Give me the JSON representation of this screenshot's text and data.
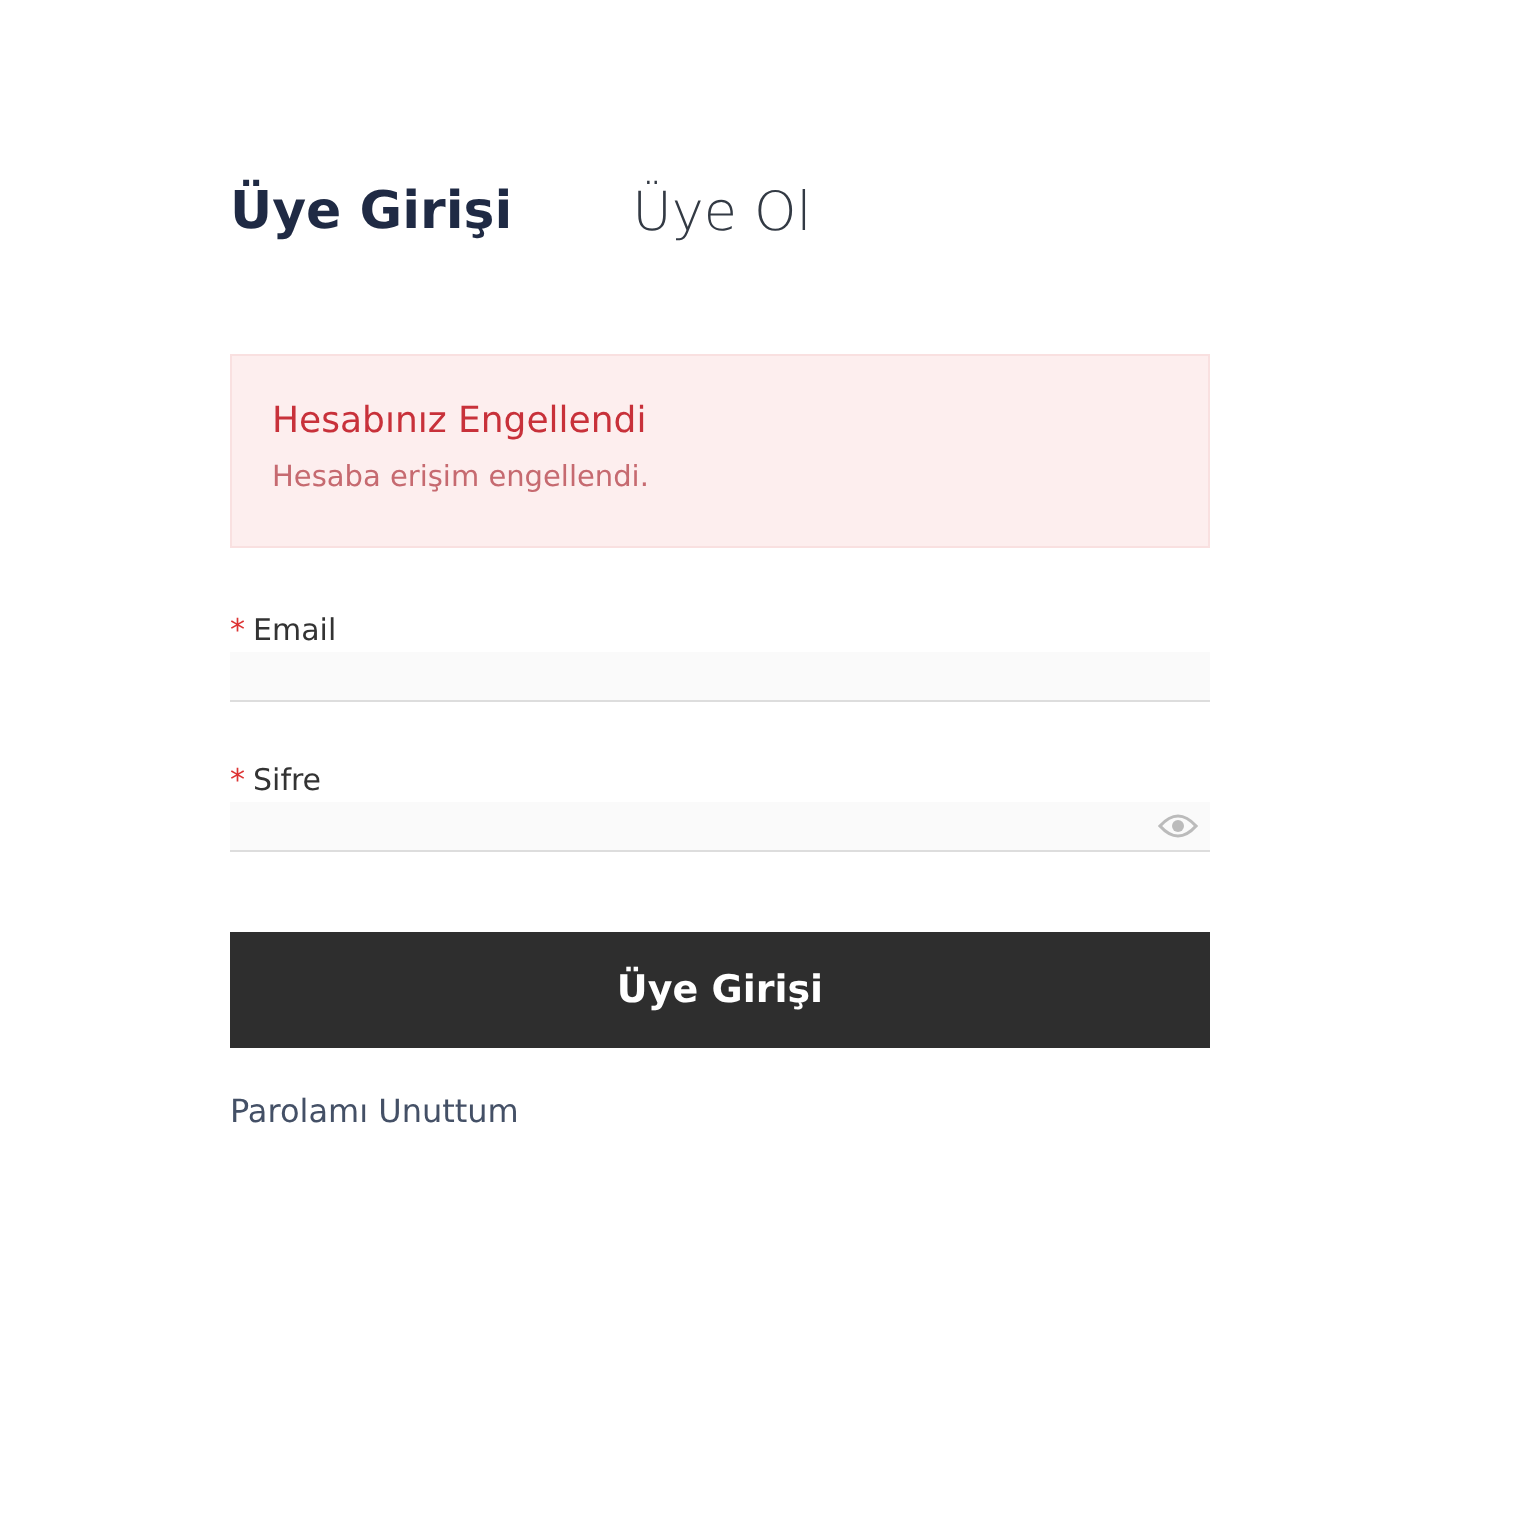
{
  "tabs": [
    {
      "label": "Üye Girişi",
      "selected": true
    },
    {
      "label": "Üye Ol",
      "selected": false
    }
  ],
  "alert": {
    "title": "Hesabınız Engellendi",
    "message": "Hesaba erişim engellendi."
  },
  "fields": [
    {
      "kind": "email",
      "required_mark": "*",
      "label": "Email"
    },
    {
      "kind": "password",
      "required_mark": "*",
      "label": "Sifre"
    }
  ],
  "submit_button": "Üye Girişi",
  "forgot_link": "Parolamı Unuttum"
}
